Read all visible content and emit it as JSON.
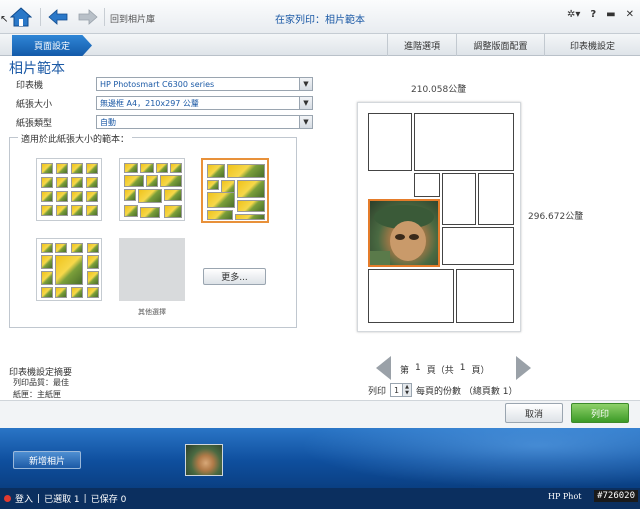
{
  "header": {
    "back_to_gallery": "回到相片庫",
    "title": "在家列印：相片範本",
    "help": "?",
    "minimize": "▬",
    "close": "✕"
  },
  "tabs": {
    "active": "頁面設定",
    "items": [
      "進階選項",
      "調整版面配置",
      "印表機設定"
    ]
  },
  "settings": {
    "section_title": "相片範本",
    "printer_label": "印表機",
    "printer_value": "HP Photosmart C6300 series",
    "paper_size_label": "紙張大小",
    "paper_size_value": "無邊框 A4，210x297 公釐",
    "paper_type_label": "紙張類型",
    "paper_type_value": "自動",
    "templates_title": "適用於此紙張大小的範本：",
    "other_label": "其他選擇",
    "more_button": "更多..."
  },
  "summary": {
    "title": "印表機設定摘要",
    "quality": "列印品質：最佳",
    "tray": "紙匣：主紙匣"
  },
  "preview": {
    "width_label": "210.058公釐",
    "height_label": "296.672公釐",
    "page_prefix": "第",
    "page_current": "1",
    "page_mid": "頁（共",
    "page_total": "1",
    "page_suffix": "頁）",
    "print_label": "列印",
    "copies_value": "1",
    "copies_suffix": "每頁的份數 （總頁數 1）"
  },
  "actions": {
    "cancel": "取消",
    "print": "列印"
  },
  "tray": {
    "add_photo": "新增相片"
  },
  "status": {
    "login": "登入",
    "selected": "已選取 1",
    "saved": "已保存 0",
    "brand": "HP Phot",
    "watermark": "#726020"
  }
}
